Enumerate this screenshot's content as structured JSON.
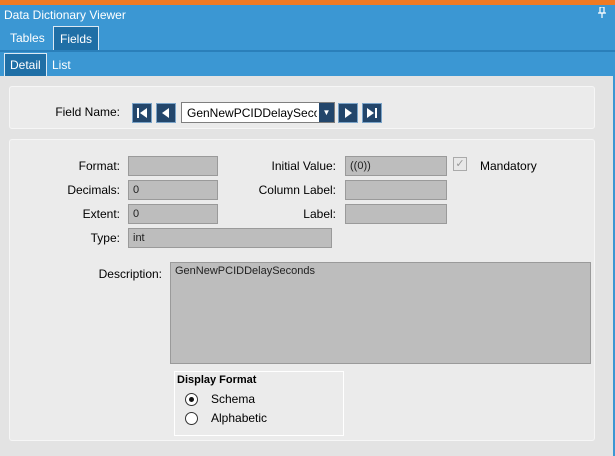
{
  "window": {
    "title": "Data Dictionary Viewer",
    "pin_icon": "pin-icon"
  },
  "tabs": [
    {
      "label": "Tables"
    },
    {
      "label": "Fields"
    }
  ],
  "subtabs": [
    {
      "label": "Detail"
    },
    {
      "label": "List"
    }
  ],
  "navigator": {
    "label": "Field Name:",
    "value": "GenNewPCIDDelaySeconds",
    "buttons": [
      "first-icon",
      "prev-icon",
      "next-icon",
      "last-icon"
    ]
  },
  "form": {
    "format_label": "Format:",
    "format_value": "",
    "decimals_label": "Decimals:",
    "decimals_value": "0",
    "extent_label": "Extent:",
    "extent_value": "0",
    "type_label": "Type:",
    "type_value": "int",
    "initial_value_label": "Initial Value:",
    "initial_value": "((0))",
    "column_label_label": "Column Label:",
    "column_label_value": "",
    "label_label": "Label:",
    "label_value": "",
    "mandatory_label": "Mandatory",
    "mandatory_checked": true,
    "description_label": "Description:",
    "description_value": "GenNewPCIDDelaySeconds"
  },
  "display_format": {
    "title": "Display Format",
    "options": [
      {
        "label": "Schema",
        "selected": true
      },
      {
        "label": "Alphabetic",
        "selected": false
      }
    ]
  },
  "colors": {
    "accent": "#3b97d3",
    "top_strip": "#f07a22",
    "nav_button": "#23466b",
    "background": "#e3e3e3"
  }
}
